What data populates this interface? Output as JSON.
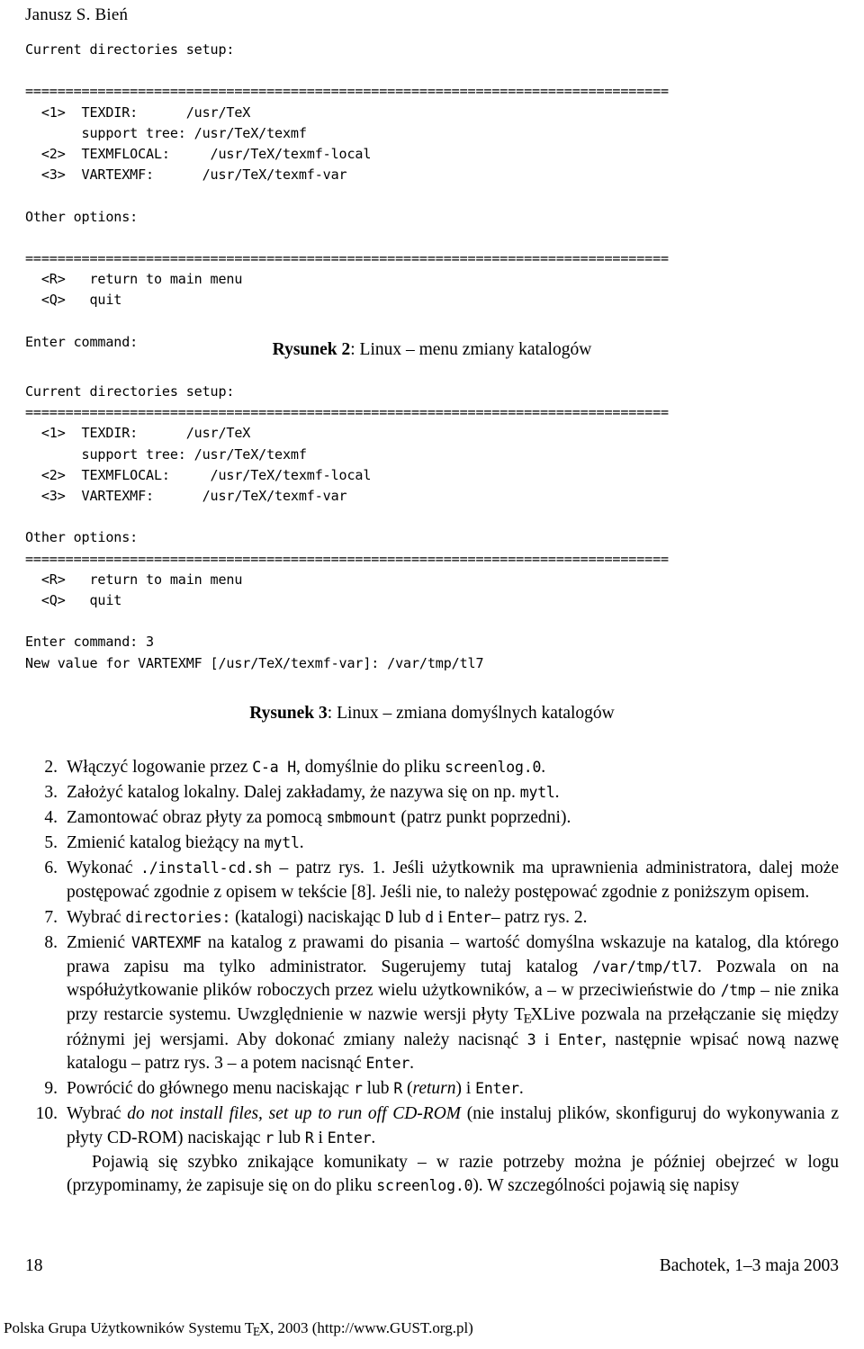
{
  "running_head": "Janusz S. Bień",
  "terminal_block_1": {
    "lines": [
      "Current directories setup:",
      "",
      "================================================================================",
      "  <1>  TEXDIR:      /usr/TeX",
      "       support tree: /usr/TeX/texmf",
      "  <2>  TEXMFLOCAL:     /usr/TeX/texmf-local",
      "  <3>  VARTEXMF:      /usr/TeX/texmf-var",
      "",
      "Other options:",
      "",
      "================================================================================",
      "  <R>   return to main menu",
      "  <Q>   quit",
      "",
      "Enter command:"
    ]
  },
  "caption_2": {
    "lead": "Rysunek 2",
    "text": ": Linux – menu zmiany katalogów"
  },
  "terminal_block_2": {
    "lines": [
      "Current directories setup:",
      "================================================================================",
      "  <1>  TEXDIR:      /usr/TeX",
      "       support tree: /usr/TeX/texmf",
      "  <2>  TEXMFLOCAL:     /usr/TeX/texmf-local",
      "  <3>  VARTEXMF:      /usr/TeX/texmf-var",
      "",
      "Other options:",
      "================================================================================",
      "  <R>   return to main menu",
      "  <Q>   quit",
      "",
      "Enter command: 3",
      "New value for VARTEXMF [/usr/TeX/texmf-var]: /var/tmp/tl7"
    ]
  },
  "caption_3": {
    "lead": "Rysunek 3",
    "text": ": Linux – zmiana domyślnych katalogów"
  },
  "list": {
    "items": [
      {
        "num": "2.",
        "parts": [
          {
            "t": "txt",
            "v": "Włączyć logowanie przez "
          },
          {
            "t": "code",
            "v": "C-a H"
          },
          {
            "t": "txt",
            "v": ", domyślnie do pliku "
          },
          {
            "t": "code",
            "v": "screenlog.0"
          },
          {
            "t": "txt",
            "v": "."
          }
        ]
      },
      {
        "num": "3.",
        "parts": [
          {
            "t": "txt",
            "v": "Założyć katalog lokalny. Dalej zakładamy, że nazywa się on np. "
          },
          {
            "t": "code",
            "v": "mytl"
          },
          {
            "t": "txt",
            "v": "."
          }
        ]
      },
      {
        "num": "4.",
        "parts": [
          {
            "t": "txt",
            "v": "Zamontować obraz płyty za pomocą "
          },
          {
            "t": "code",
            "v": "smbmount"
          },
          {
            "t": "txt",
            "v": " (patrz punkt poprzedni)."
          }
        ]
      },
      {
        "num": "5.",
        "parts": [
          {
            "t": "txt",
            "v": "Zmienić katalog bieżący na "
          },
          {
            "t": "code",
            "v": "mytl"
          },
          {
            "t": "txt",
            "v": "."
          }
        ]
      },
      {
        "num": "6.",
        "parts": [
          {
            "t": "txt",
            "v": "Wykonać "
          },
          {
            "t": "code",
            "v": "./install-cd.sh"
          },
          {
            "t": "txt",
            "v": " – patrz rys. 1. Jeśli użytkownik ma uprawnienia administratora, dalej może postępować zgodnie z opisem w tekście [8]. Jeśli nie, to należy postępować zgodnie z poniższym opisem."
          }
        ]
      },
      {
        "num": "7.",
        "parts": [
          {
            "t": "txt",
            "v": "Wybrać "
          },
          {
            "t": "code",
            "v": "directories:"
          },
          {
            "t": "txt",
            "v": " (katalogi) naciskając "
          },
          {
            "t": "code",
            "v": "D"
          },
          {
            "t": "txt",
            "v": " lub "
          },
          {
            "t": "code",
            "v": "d"
          },
          {
            "t": "txt",
            "v": " i "
          },
          {
            "t": "code",
            "v": "Enter"
          },
          {
            "t": "txt",
            "v": "– patrz rys. 2."
          }
        ]
      },
      {
        "num": "8.",
        "parts": [
          {
            "t": "txt",
            "v": "Zmienić "
          },
          {
            "t": "code",
            "v": "VARTEXMF"
          },
          {
            "t": "txt",
            "v": " na katalog z prawami do pisania – wartość domyślna wskazuje na katalog, dla którego prawa zapisu ma tylko administrator. Sugerujemy tutaj katalog "
          },
          {
            "t": "code",
            "v": "/var/tmp/tl7"
          },
          {
            "t": "txt",
            "v": ". Pozwala on na współużytkowanie plików roboczych przez wielu użytkowników, a – w przeciwieństwie do "
          },
          {
            "t": "code",
            "v": "/tmp"
          },
          {
            "t": "txt",
            "v": " – nie znika przy restarcie systemu. Uwzględnienie w nazwie wersji płyty "
          },
          {
            "t": "tex",
            "v": "TeX"
          },
          {
            "t": "txt",
            "v": "Live pozwala na przełączanie się między różnymi jej wersjami. Aby dokonać zmiany należy nacisnąć "
          },
          {
            "t": "code",
            "v": "3"
          },
          {
            "t": "txt",
            "v": " i "
          },
          {
            "t": "code",
            "v": "Enter"
          },
          {
            "t": "txt",
            "v": ", następnie wpisać nową nazwę katalogu – patrz rys. 3 – a potem nacisnąć "
          },
          {
            "t": "code",
            "v": "Enter"
          },
          {
            "t": "txt",
            "v": "."
          }
        ]
      },
      {
        "num": "9.",
        "parts": [
          {
            "t": "txt",
            "v": "Powrócić do głównego menu naciskając "
          },
          {
            "t": "code",
            "v": "r"
          },
          {
            "t": "txt",
            "v": " lub "
          },
          {
            "t": "code",
            "v": "R"
          },
          {
            "t": "txt",
            "v": " ("
          },
          {
            "t": "it",
            "v": "return"
          },
          {
            "t": "txt",
            "v": ") i "
          },
          {
            "t": "code",
            "v": "Enter"
          },
          {
            "t": "txt",
            "v": "."
          }
        ]
      },
      {
        "num": "10.",
        "parts": [
          {
            "t": "txt",
            "v": "Wybrać "
          },
          {
            "t": "it",
            "v": "do not install files, set up to run off CD-ROM"
          },
          {
            "t": "txt",
            "v": " (nie instaluj plików, skonfiguruj do wykonywania z płyty CD-ROM) naciskając "
          },
          {
            "t": "code",
            "v": "r"
          },
          {
            "t": "txt",
            "v": " lub "
          },
          {
            "t": "code",
            "v": "R"
          },
          {
            "t": "txt",
            "v": " i "
          },
          {
            "t": "code",
            "v": "Enter"
          },
          {
            "t": "txt",
            "v": "."
          }
        ],
        "trailing_paragraph": [
          {
            "t": "txt",
            "v": "Pojawią się szybko znikające komunikaty – w razie potrzeby można je później obejrzeć w logu (przypominamy, że zapisuje się on do pliku "
          },
          {
            "t": "code",
            "v": "screenlog.0"
          },
          {
            "t": "txt",
            "v": "). W szczególności pojawią się napisy"
          }
        ]
      }
    ]
  },
  "footer": {
    "page_number": "18",
    "venue": "Bachotek, 1–3 maja 2003",
    "colophon_pre": "Polska Grupa Użytkowników Systemu ",
    "colophon_tex": "TeX",
    "colophon_post": ", 2003 (http://www.GUST.org.pl)"
  }
}
